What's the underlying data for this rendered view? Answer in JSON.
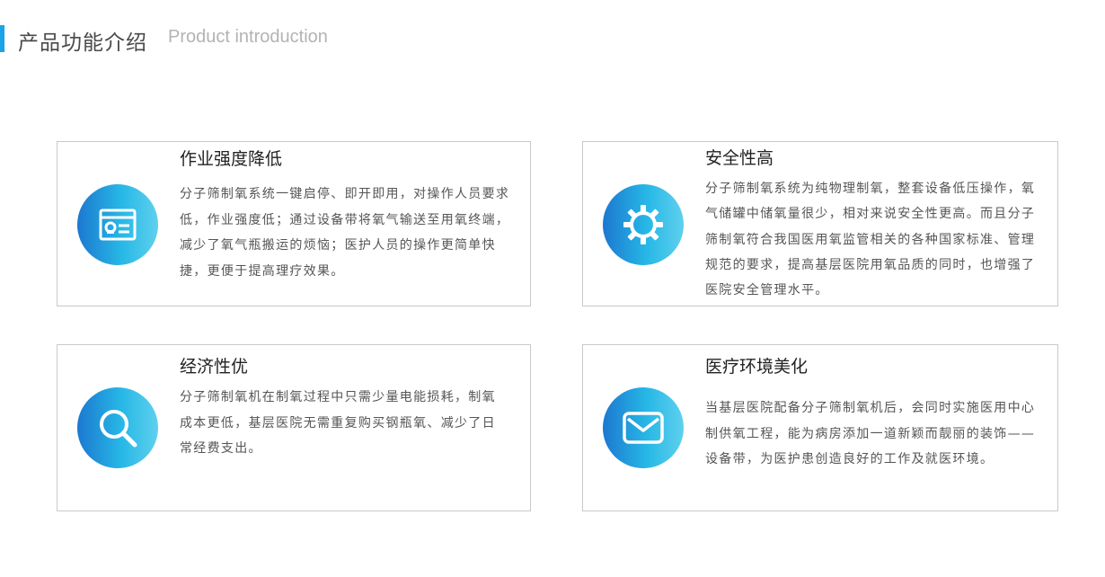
{
  "header": {
    "title": "产品功能介绍",
    "subtitle": "Product introduction",
    "accent_color": "#1aa3e8"
  },
  "cards": [
    {
      "icon": "id-card-icon",
      "title": "作业强度降低",
      "description": "分子筛制氧系统一键启停、即开即用，对操作人员要求低，作业强度低；通过设备带将氧气输送至用氧终端，减少了氧气瓶搬运的烦恼；医护人员的操作更简单快捷，更便于提高理疗效果。"
    },
    {
      "icon": "gear-icon",
      "title": "安全性高",
      "description": "分子筛制氧系统为纯物理制氧，整套设备低压操作，氧气储罐中储氧量很少，相对来说安全性更高。而且分子筛制氧符合我国医用氧监管相关的各种国家标准、管理规范的要求，提高基层医院用氧品质的同时，也增强了医院安全管理水平。"
    },
    {
      "icon": "search-icon",
      "title": "经济性优",
      "description": "分子筛制氧机在制氧过程中只需少量电能损耗，制氧成本更低，基层医院无需重复购买钢瓶氧、减少了日常经费支出。"
    },
    {
      "icon": "mail-icon",
      "title": "医疗环境美化",
      "description": "当基层医院配备分子筛制氧机后，会同时实施医用中心制供氧工程，能为病房添加一道新颖而靓丽的装饰——设备带，为医护患创造良好的工作及就医环境。"
    }
  ],
  "colors": {
    "gradient_start": "#1c78d0",
    "gradient_end": "#5fd0ee",
    "border": "#c9c9c9"
  }
}
